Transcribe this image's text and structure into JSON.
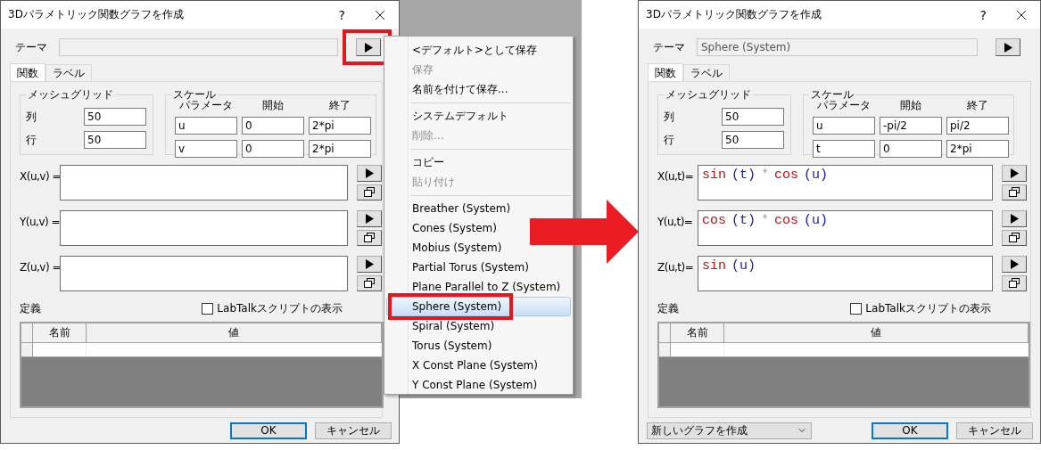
{
  "left_dialog": {
    "title": "3Dパラメトリック関数グラフを作成",
    "help": "?",
    "theme": {
      "label": "テーマ",
      "button_marked": true
    },
    "tabs": [
      {
        "label": "関数",
        "selected": true
      },
      {
        "label": "ラベル",
        "selected": false
      }
    ],
    "mesh_grid": {
      "title": "メッシュグリッド",
      "rows": [
        {
          "label": "列",
          "value": "50"
        },
        {
          "label": "行",
          "value": "50"
        }
      ]
    },
    "scale": {
      "title": "スケール",
      "headers": [
        "パラメータ",
        "開始",
        "終了"
      ],
      "rows": [
        [
          "u",
          "0",
          "2*pi"
        ],
        [
          "v",
          "0",
          "2*pi"
        ]
      ]
    },
    "functions": [
      {
        "label": "X(u,v) ="
      },
      {
        "label": "Y(u,v) ="
      },
      {
        "label": "Z(u,v) ="
      }
    ],
    "definitions": {
      "label": "定義",
      "checkbox": {
        "label": "LabTalkスクリプトの表示",
        "checked": false
      },
      "columns": [
        "名前",
        "値"
      ]
    },
    "buttons": [
      {
        "label": "OK",
        "default": true
      },
      {
        "label": "キャンセル",
        "default": false
      }
    ]
  },
  "theme_menu": {
    "items": [
      {
        "kind": "item",
        "label": "<デフォルト>として保存",
        "disabled": false,
        "selected": false,
        "marked": false
      },
      {
        "kind": "item",
        "label": "保存",
        "disabled": true,
        "selected": false,
        "marked": false
      },
      {
        "kind": "item",
        "label": "名前を付けて保存...",
        "disabled": false,
        "selected": false,
        "marked": false
      },
      {
        "kind": "separator"
      },
      {
        "kind": "item",
        "label": "システムデフォルト",
        "disabled": false,
        "selected": false,
        "marked": false
      },
      {
        "kind": "item",
        "label": "削除...",
        "disabled": true,
        "selected": false,
        "marked": false
      },
      {
        "kind": "separator"
      },
      {
        "kind": "item",
        "label": "コピー",
        "disabled": false,
        "selected": false,
        "marked": false
      },
      {
        "kind": "item",
        "label": "貼り付け",
        "disabled": true,
        "selected": false,
        "marked": false
      },
      {
        "kind": "separator"
      },
      {
        "kind": "item",
        "label": "Breather (System)",
        "disabled": false,
        "selected": false,
        "marked": false
      },
      {
        "kind": "item",
        "label": "Cones (System)",
        "disabled": false,
        "selected": false,
        "marked": false
      },
      {
        "kind": "item",
        "label": "Mobius (System)",
        "disabled": false,
        "selected": false,
        "marked": false
      },
      {
        "kind": "item",
        "label": "Partial Torus (System)",
        "disabled": false,
        "selected": false,
        "marked": false
      },
      {
        "kind": "item",
        "label": "Plane Parallel to Z (System)",
        "disabled": false,
        "selected": false,
        "marked": false
      },
      {
        "kind": "item",
        "label": "Sphere (System)",
        "disabled": false,
        "selected": true,
        "marked": true
      },
      {
        "kind": "item",
        "label": "Spiral (System)",
        "disabled": false,
        "selected": false,
        "marked": false
      },
      {
        "kind": "item",
        "label": "Torus (System)",
        "disabled": false,
        "selected": false,
        "marked": false
      },
      {
        "kind": "item",
        "label": "X Const Plane (System)",
        "disabled": false,
        "selected": false,
        "marked": false
      },
      {
        "kind": "item",
        "label": "Y Const Plane (System)",
        "disabled": false,
        "selected": false,
        "marked": false
      }
    ]
  },
  "right_dialog": {
    "title": "3Dパラメトリック関数グラフを作成",
    "help": "?",
    "theme": {
      "label": "テーマ",
      "value": "Sphere (System)",
      "button_marked": false
    },
    "tabs": [
      {
        "label": "関数",
        "selected": true
      },
      {
        "label": "ラベル",
        "selected": false
      }
    ],
    "mesh_grid": {
      "title": "メッシュグリッド",
      "rows": [
        {
          "label": "列",
          "value": "50"
        },
        {
          "label": "行",
          "value": "50"
        }
      ]
    },
    "scale": {
      "title": "スケール",
      "headers": [
        "パラメータ",
        "開始",
        "終了"
      ],
      "rows": [
        [
          "u",
          "-pi/2",
          "pi/2"
        ],
        [
          "t",
          "0",
          "2*pi"
        ]
      ]
    },
    "functions": [
      {
        "label": "X(u,t)=",
        "tokens": [
          {
            "text": "sin",
            "kind": "function"
          },
          {
            "text": "(t)",
            "kind": "argument"
          },
          {
            "text": "*",
            "kind": "operator"
          },
          {
            "text": "cos",
            "kind": "function"
          },
          {
            "text": "(u)",
            "kind": "argument"
          }
        ]
      },
      {
        "label": "Y(u,t)=",
        "tokens": [
          {
            "text": "cos",
            "kind": "function"
          },
          {
            "text": "(t)",
            "kind": "argument"
          },
          {
            "text": "*",
            "kind": "operator"
          },
          {
            "text": "cos",
            "kind": "function"
          },
          {
            "text": "(u)",
            "kind": "argument"
          }
        ]
      },
      {
        "label": "Z(u,t)=",
        "tokens": [
          {
            "text": "sin",
            "kind": "function"
          },
          {
            "text": "(u)",
            "kind": "argument"
          }
        ]
      }
    ],
    "definitions": {
      "label": "定義",
      "checkbox": {
        "label": "LabTalkスクリプトの表示",
        "checked": false
      },
      "columns": [
        "名前",
        "値"
      ]
    },
    "graph_select": {
      "value": "新しいグラフを作成"
    },
    "buttons": [
      {
        "label": "OK",
        "default": true
      },
      {
        "label": "キャンセル",
        "default": false
      }
    ]
  }
}
